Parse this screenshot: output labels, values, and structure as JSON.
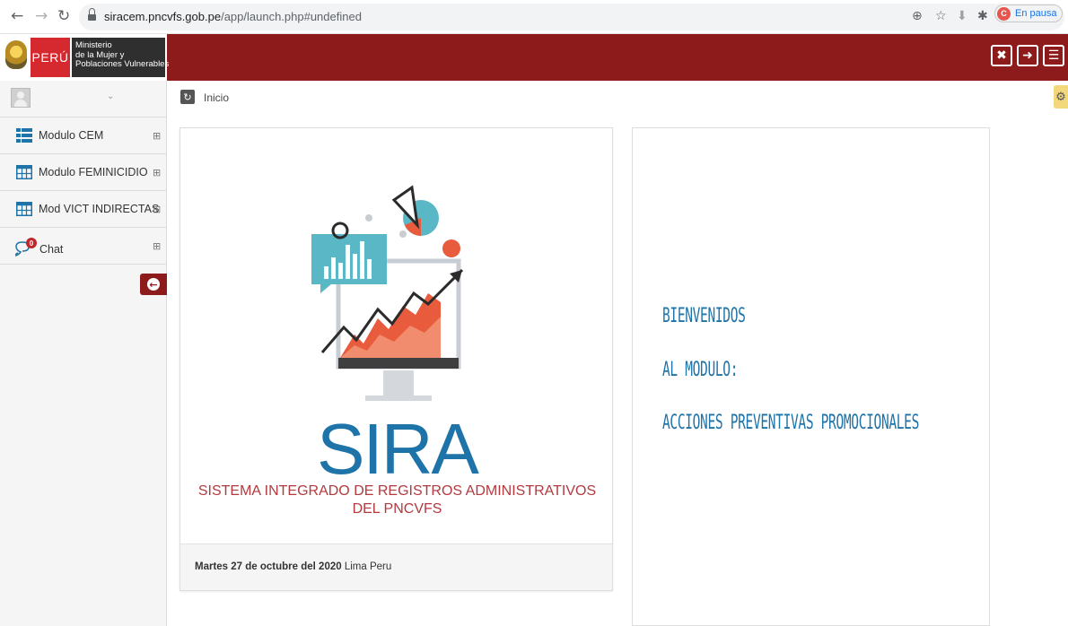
{
  "browser": {
    "url_domain": "siracem.pncvfs.gob.pe",
    "url_path": "/app/launch.php#undefined",
    "profile_initial": "C",
    "profile_status": "En pausa"
  },
  "header": {
    "logo_country": "PERÚ",
    "ministry_lines": [
      "Ministerio",
      "de la Mujer y",
      "Poblaciones Vulnerables"
    ],
    "header_color": "#8e1b1b"
  },
  "sidebar": {
    "items": [
      {
        "label": "Modulo CEM",
        "icon": "list-icon"
      },
      {
        "label": "Modulo FEMINICIDIO",
        "icon": "table-icon"
      },
      {
        "label": "Mod VICT INDIRECTAS",
        "icon": "table-icon"
      },
      {
        "label": "Chat",
        "icon": "chat-icon",
        "badge": "0"
      }
    ]
  },
  "breadcrumb": {
    "label": "Inicio"
  },
  "main": {
    "logo_word": "SIRA",
    "logo_subtitle_lines": [
      "SISTEMA INTEGRADO DE REGISTROS ADMINISTRATIVOS",
      "DEL PNCVFS"
    ],
    "footer_date": "Martes 27 de octubre del 2020",
    "footer_place": "Lima Peru",
    "welcome_lines": [
      "BIENVENIDOS",
      "AL MODULO:",
      "ACCIONES PREVENTIVAS PROMOCIONALES"
    ]
  }
}
